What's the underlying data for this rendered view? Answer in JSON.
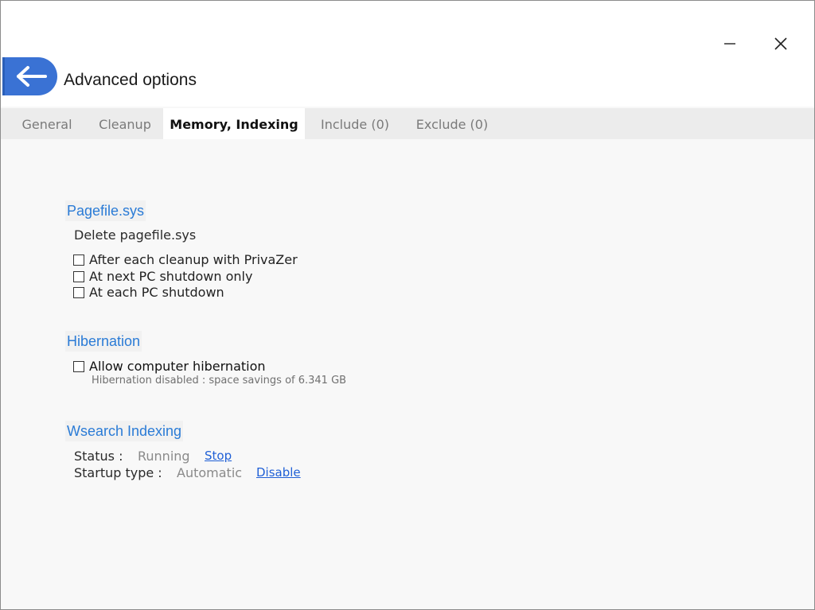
{
  "window": {
    "title": "Advanced options",
    "minimize_icon": "minimize-icon",
    "close_icon": "close-icon",
    "back_icon": "arrow-left-icon"
  },
  "tabs": [
    {
      "label": "General",
      "active": false
    },
    {
      "label": "Cleanup",
      "active": false
    },
    {
      "label": "Memory, Indexing",
      "active": true
    },
    {
      "label": "Include (0)",
      "active": false
    },
    {
      "label": "Exclude (0)",
      "active": false
    }
  ],
  "pagefile": {
    "title": "Pagefile.sys",
    "subtitle": "Delete pagefile.sys",
    "options": [
      {
        "label": "After each cleanup with PrivaZer",
        "checked": false
      },
      {
        "label": "At next PC shutdown only",
        "checked": false
      },
      {
        "label": "At each PC shutdown",
        "checked": false
      }
    ]
  },
  "hibernation": {
    "title": "Hibernation",
    "option": {
      "label": "Allow computer hibernation",
      "checked": false
    },
    "note": "Hibernation disabled : space savings of 6.341 GB"
  },
  "wsearch": {
    "title": "Wsearch Indexing",
    "status_label": "Status :",
    "status_value": "Running",
    "status_action": "Stop",
    "startup_label": "Startup type :",
    "startup_value": "Automatic",
    "startup_action": "Disable"
  },
  "colors": {
    "accent": "#3a72d4",
    "section_title": "#2a7bd6",
    "link": "#1f5fd6"
  }
}
